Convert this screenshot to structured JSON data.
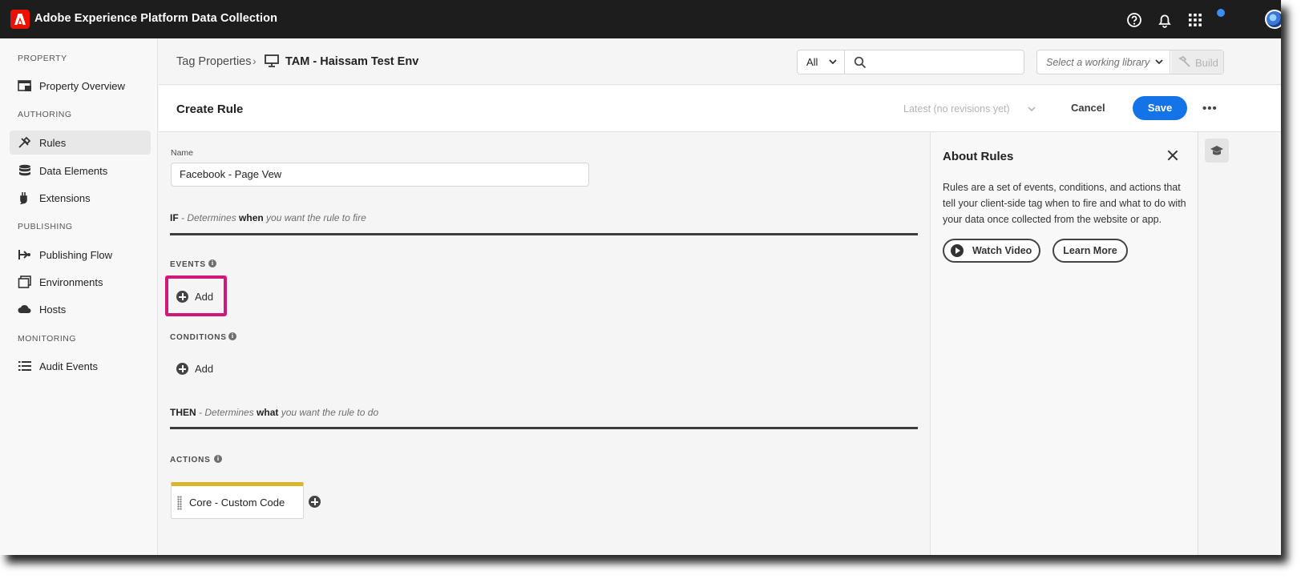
{
  "shell": {
    "app_title": "Adobe Experience Platform Data Collection",
    "icons": [
      "help-icon",
      "bell-icon",
      "apps-grid-icon",
      "avatar"
    ]
  },
  "sidebar": {
    "sections": [
      {
        "label": "PROPERTY",
        "items": [
          {
            "label": "Property Overview",
            "icon": "property-overview-icon"
          }
        ]
      },
      {
        "label": "AUTHORING",
        "items": [
          {
            "label": "Rules",
            "icon": "rules-icon",
            "active": true
          },
          {
            "label": "Data Elements",
            "icon": "data-elements-icon"
          },
          {
            "label": "Extensions",
            "icon": "extensions-icon"
          }
        ]
      },
      {
        "label": "PUBLISHING",
        "items": [
          {
            "label": "Publishing Flow",
            "icon": "publishing-flow-icon"
          },
          {
            "label": "Environments",
            "icon": "environments-icon"
          },
          {
            "label": "Hosts",
            "icon": "hosts-icon"
          }
        ]
      },
      {
        "label": "MONITORING",
        "items": [
          {
            "label": "Audit Events",
            "icon": "audit-events-icon"
          }
        ]
      }
    ]
  },
  "header": {
    "breadcrumb_root": "Tag Properties",
    "breadcrumb_sep": "›",
    "breadcrumb_current": "TAM - Haissam Test Env",
    "filter_value": "All",
    "search_placeholder": "",
    "library_placeholder": "Select a working library",
    "build_label": "Build"
  },
  "rule_bar": {
    "title": "Create Rule",
    "revision": "Latest (no revisions yet)",
    "cancel_label": "Cancel",
    "save_label": "Save",
    "more_label": "•••"
  },
  "form": {
    "name_label": "Name",
    "name_value": "Facebook - Page Vew",
    "if_key": "IF",
    "if_text_1": " - Determines ",
    "if_bold": "when",
    "if_text_2": " you want the rule to fire",
    "events_label": "EVENTS",
    "events_add": "Add",
    "conditions_label": "CONDITIONS",
    "conditions_add": "Add",
    "then_key": "THEN",
    "then_text_1": " - Determines ",
    "then_bold": "what",
    "then_text_2": " you want the rule to do",
    "actions_label": "ACTIONS",
    "action_item": "Core - Custom Code",
    "highlight_color": "#d1177a"
  },
  "about": {
    "title": "About Rules",
    "text": "Rules are a set of events, conditions, and actions that tell your client-side tag when to fire and what to do with your data once collected from the website or app.",
    "watch_video": "Watch Video",
    "learn_more": "Learn More"
  },
  "colors": {
    "accent": "#1473e6",
    "shell_bg": "#1d1d1d",
    "adobe_red": "#eb1000",
    "action_bar": "#d8b52a"
  }
}
